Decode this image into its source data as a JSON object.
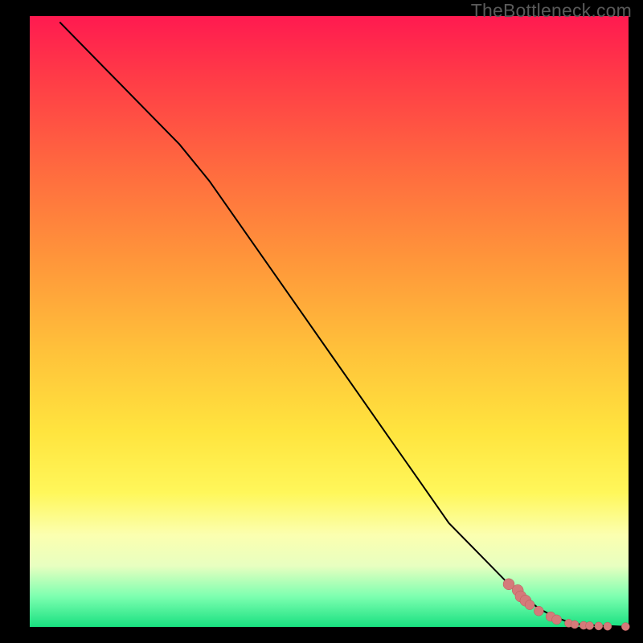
{
  "watermark": "TheBottleneck.com",
  "colors": {
    "line": "#000000",
    "marker_fill": "#d47a7a",
    "marker_stroke": "#b95959"
  },
  "chart_data": {
    "type": "line",
    "title": "",
    "xlabel": "",
    "ylabel": "",
    "xlim": [
      0,
      100
    ],
    "ylim": [
      0,
      100
    ],
    "grid": false,
    "legend": false,
    "series": [
      {
        "name": "curve",
        "style": "line",
        "x": [
          5,
          10,
          15,
          20,
          25,
          30,
          35,
          40,
          45,
          50,
          55,
          60,
          65,
          70,
          75,
          80,
          82,
          85,
          88,
          90,
          92,
          95,
          98,
          100
        ],
        "values": [
          99,
          94,
          89,
          84,
          79,
          73,
          66,
          59,
          52,
          45,
          38,
          31,
          24,
          17,
          12,
          7,
          5.5,
          3,
          1.5,
          0.8,
          0.4,
          0.2,
          0.1,
          0
        ]
      },
      {
        "name": "markers",
        "style": "scatter",
        "x": [
          80,
          81.5,
          82,
          82.8,
          83.5,
          85,
          87,
          88,
          90,
          91,
          92.5,
          93.5,
          95,
          96.5,
          99.5
        ],
        "values": [
          7,
          6.0,
          5.0,
          4.3,
          3.6,
          2.6,
          1.7,
          1.2,
          0.6,
          0.4,
          0.25,
          0.2,
          0.15,
          0.1,
          0.05
        ]
      }
    ]
  }
}
